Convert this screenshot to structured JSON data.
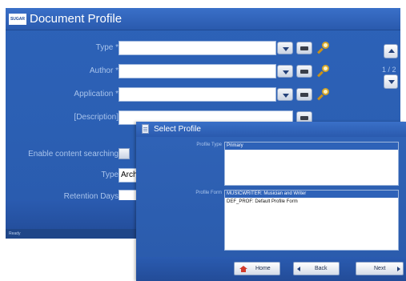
{
  "main_window": {
    "logo_text": "SUGAR",
    "title": "Document Profile",
    "fields": [
      {
        "label": "Type *",
        "value": ""
      },
      {
        "label": "Author *",
        "value": ""
      },
      {
        "label": "Application *",
        "value": ""
      },
      {
        "label": "[Description]",
        "value": ""
      },
      {
        "label": "Enable content searching",
        "value": ""
      },
      {
        "label": "Type",
        "value": "Archiv"
      },
      {
        "label": "Retention Days",
        "value": ""
      }
    ],
    "page_indicator": "1 / 2",
    "status": "Ready"
  },
  "dialog": {
    "title": "Select Profile",
    "profile_type_label": "Profile Type",
    "profile_types": [
      "Primary"
    ],
    "profile_form_label": "Profile Form",
    "profile_forms": [
      "MUSICWRITER: Musician and Writer",
      "DEF_PROF: Default Profile Form"
    ],
    "selected_form_index": 0,
    "buttons": {
      "home": "Home",
      "back": "Back",
      "next": "Next"
    }
  },
  "icons": [
    "logo",
    "chevron-down-icon",
    "keyboard-icon",
    "search-icon",
    "scroll-up-icon",
    "scroll-down-icon",
    "document-icon",
    "home-icon",
    "back-arrow-icon",
    "next-arrow-icon"
  ]
}
